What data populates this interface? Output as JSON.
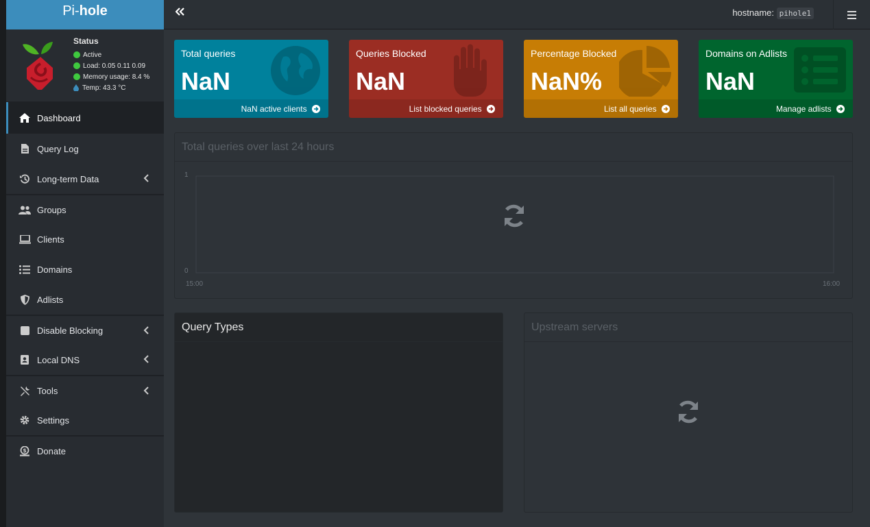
{
  "brand": {
    "prefix": "Pi-",
    "name": "hole"
  },
  "status": {
    "title": "Status",
    "active": "Active",
    "load": "Load:  0.05  0.11  0.09",
    "memory": "Memory usage:  8.4 %",
    "temp": "Temp: 43.3 °C"
  },
  "nav": {
    "dashboard": "Dashboard",
    "query_log": "Query Log",
    "long_term": "Long-term Data",
    "groups": "Groups",
    "clients": "Clients",
    "domains": "Domains",
    "adlists": "Adlists",
    "disable_blocking": "Disable Blocking",
    "local_dns": "Local DNS",
    "tools": "Tools",
    "settings": "Settings",
    "donate": "Donate"
  },
  "header": {
    "hostname_label": "hostname:",
    "hostname_value": "pihole1"
  },
  "stats": [
    {
      "label": "Total queries",
      "value": "NaN",
      "footer": "NaN active clients",
      "color": "#00819c",
      "icon": "globe-icon"
    },
    {
      "label": "Queries Blocked",
      "value": "NaN",
      "footer": "List blocked queries",
      "color": "#9b2d23",
      "icon": "hand-icon"
    },
    {
      "label": "Percentage Blocked",
      "value": "NaN%",
      "footer": "List all queries",
      "color": "#c77d05",
      "icon": "pie-chart-icon"
    },
    {
      "label": "Domains on Adlists",
      "value": "NaN",
      "footer": "Manage adlists",
      "color": "#00652e",
      "icon": "list-icon"
    }
  ],
  "chart_data": {
    "type": "area",
    "title": "Total queries over last 24 hours",
    "x_ticks": [
      "15:00",
      "16:00"
    ],
    "y_ticks": [
      "1",
      "0"
    ],
    "ylim": [
      0,
      1
    ],
    "series": []
  },
  "panels": {
    "query_types": "Query Types",
    "upstream": "Upstream servers"
  }
}
